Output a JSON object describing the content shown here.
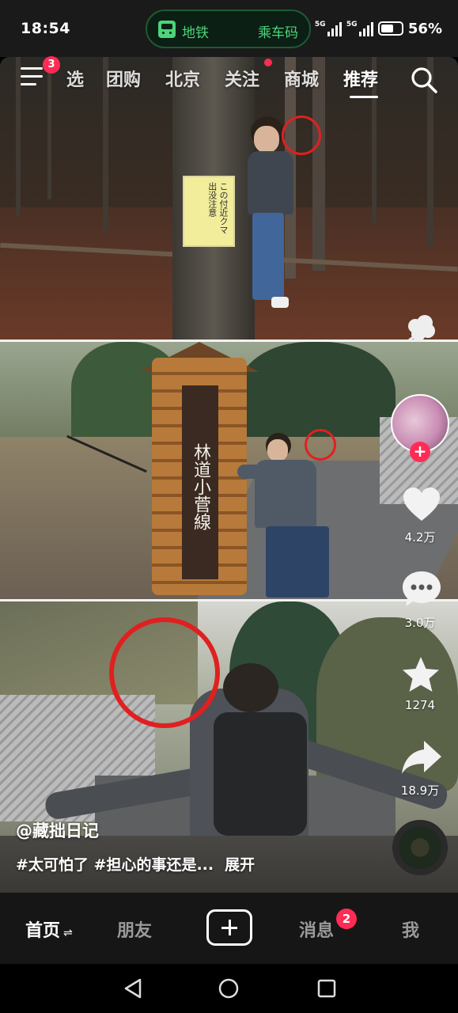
{
  "status_bar": {
    "time": "18:54",
    "transit_pill": {
      "left_label": "地铁",
      "right_label": "乘车码"
    },
    "network_1": "5G",
    "network_2": "5G",
    "battery": "56%"
  },
  "top_nav": {
    "menu_badge": "3",
    "tabs": [
      "选",
      "团购",
      "北京",
      "关注",
      "商城",
      "推荐"
    ],
    "active_tab": "推荐",
    "follow_has_dot": true
  },
  "photo_sign": {
    "text": "この付近クマ出没注意"
  },
  "photo_board": {
    "text": "林道小菅線"
  },
  "right_rail": {
    "likes": "4.2万",
    "comments": "3.0万",
    "favorites": "1274",
    "shares": "18.9万"
  },
  "post": {
    "author": "@藏拙日记",
    "caption": "#太可怕了 #担心的事还是...",
    "expand": "展开"
  },
  "bottom_tabs": {
    "home": "首页",
    "friends": "朋友",
    "messages": "消息",
    "messages_badge": "2",
    "me": "我"
  },
  "colors": {
    "accent": "#fe2c55",
    "transit_green": "#4cd47a",
    "background": "#161616"
  }
}
